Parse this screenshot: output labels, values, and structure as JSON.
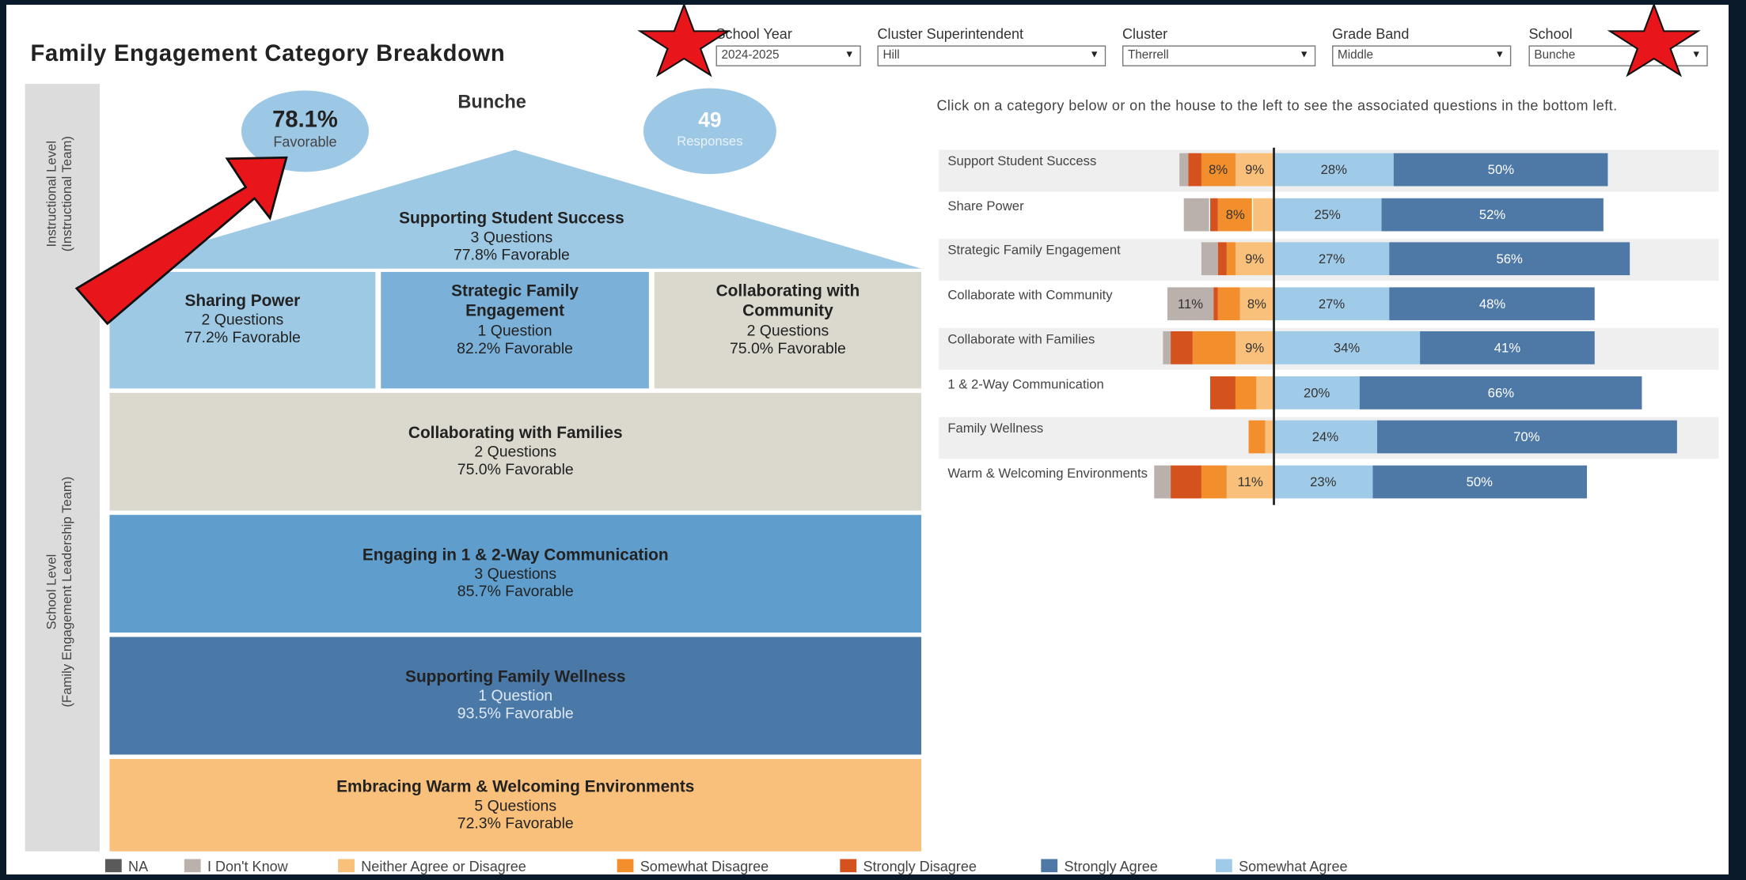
{
  "title": "Family Engagement Category Breakdown",
  "filters": [
    {
      "label": "School Year",
      "value": "2024-2025"
    },
    {
      "label": "Cluster Superintendent",
      "value": "Hill"
    },
    {
      "label": "Cluster",
      "value": "Therrell"
    },
    {
      "label": "Grade Band",
      "value": "Middle"
    },
    {
      "label": "School",
      "value": "Bunche"
    }
  ],
  "side_labels": {
    "instructional": "Instructional Level",
    "instructional_sub": "(Instructional Team)",
    "school": "School Level",
    "school_sub": "(Family Engagement Leadership Team)"
  },
  "house": {
    "school_name": "Bunche",
    "favorable_value": "78.1%",
    "favorable_label": "Favorable",
    "responses_value": "49",
    "responses_label": "Responses",
    "roof": {
      "name": "Supporting Student Success",
      "questions": "3 Questions",
      "favorable": "77.8% Favorable"
    },
    "pillars": [
      {
        "name": "Sharing Power",
        "questions": "2 Questions",
        "favorable": "77.2% Favorable"
      },
      {
        "name": "Strategic Family Engagement",
        "questions": "1 Question",
        "favorable": "82.2% Favorable"
      },
      {
        "name": "Collaborating with Community",
        "questions": "2 Questions",
        "favorable": "75.0% Favorable"
      }
    ],
    "floors": [
      {
        "name": "Collaborating with Families",
        "questions": "2 Questions",
        "favorable": "75.0% Favorable"
      },
      {
        "name": "Engaging in 1 & 2-Way Communication",
        "questions": "3 Questions",
        "favorable": "85.7% Favorable"
      },
      {
        "name": "Supporting Family Wellness",
        "questions": "1 Question",
        "favorable": "93.5% Favorable"
      },
      {
        "name": "Embracing Warm & Welcoming Environments",
        "questions": "5 Questions",
        "favorable": "72.3% Favorable"
      }
    ]
  },
  "instructions": "Click on a category below or on the house to the left to see the associated questions in the bottom left.",
  "colors": {
    "na": "#5a5a5a",
    "dont_know": "#bab0ac",
    "neither": "#f9c07b",
    "somewhat_disagree": "#f28e2b",
    "strongly_disagree": "#d4521e",
    "strongly_agree": "#4e79a7",
    "somewhat_agree": "#a0cbe8"
  },
  "chart_data": {
    "type": "bar",
    "categories": [
      "Support Student Success",
      "Share Power",
      "Strategic Family Engagement",
      "Collaborate with Community",
      "Collaborate with Families",
      "1 & 2-Way Communication",
      "Family Wellness",
      "Warm & Welcoming Environments"
    ],
    "series": [
      {
        "name": "I Don't Know",
        "values": [
          2,
          6,
          4,
          11,
          2,
          0,
          0,
          4
        ]
      },
      {
        "name": "Strongly Disagree",
        "values": [
          3,
          2,
          2,
          1,
          5,
          6,
          0,
          7
        ]
      },
      {
        "name": "Somewhat Disagree",
        "values": [
          8,
          8,
          2,
          5,
          10,
          5,
          4,
          6
        ]
      },
      {
        "name": "Neither Agree or Disagree",
        "values": [
          9,
          5,
          9,
          8,
          9,
          4,
          2,
          11
        ]
      },
      {
        "name": "Somewhat Agree",
        "values": [
          28,
          25,
          27,
          27,
          34,
          20,
          24,
          23
        ]
      },
      {
        "name": "Strongly Agree",
        "values": [
          50,
          52,
          56,
          48,
          41,
          66,
          70,
          50
        ]
      }
    ],
    "labels": [
      [
        "",
        "",
        "8%",
        "9%",
        "28%",
        "50%"
      ],
      [
        "",
        "",
        "8%",
        "",
        "25%",
        "52%"
      ],
      [
        "",
        "",
        "",
        "9%",
        "27%",
        "56%"
      ],
      [
        "11%",
        "",
        "",
        "8%",
        "27%",
        "48%"
      ],
      [
        "",
        "",
        "",
        "9%",
        "34%",
        "41%"
      ],
      [
        "",
        "",
        "",
        "",
        "20%",
        "66%"
      ],
      [
        "",
        "",
        "",
        "",
        "24%",
        "70%"
      ],
      [
        "",
        "",
        "",
        "11%",
        "23%",
        "50%"
      ]
    ]
  },
  "legend": [
    "NA",
    "I Don't Know",
    "Neither Agree or Disagree",
    "Somewhat Disagree",
    "Strongly Disagree",
    "Strongly Agree",
    "Somewhat Agree"
  ]
}
